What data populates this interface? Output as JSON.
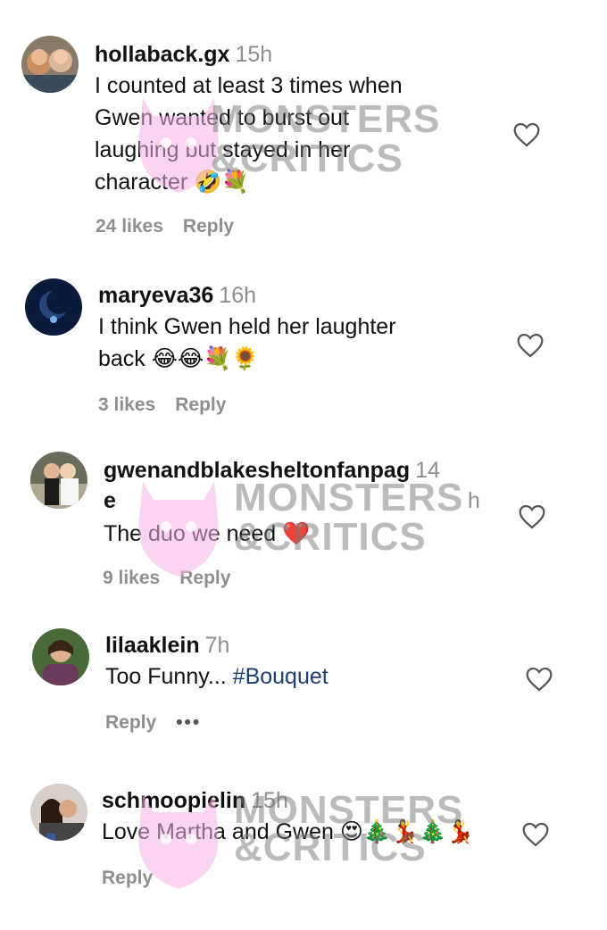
{
  "watermark": {
    "line1": "MONSTERS",
    "line2": "&CRITICS"
  },
  "comments": [
    {
      "username": "hollaback.gx",
      "time": "15h",
      "text_lines": [
        "I counted at least 3 times when",
        "Gwen wanted to burst out",
        "laughing but stayed in her",
        "character 🤣💐"
      ],
      "likes": "24 likes",
      "reply": "Reply"
    },
    {
      "username": "maryeva36",
      "time": "16h",
      "text_lines": [
        "I think Gwen held her laughter",
        "back 😂😂💐🌻"
      ],
      "likes": "3 likes",
      "reply": "Reply"
    },
    {
      "username_line1": "gwenandblakesheltonfanpag",
      "username_line2": "e",
      "time_line1": "14",
      "time_line2": "h",
      "text": "The duo we need ❤️",
      "likes": "9 likes",
      "reply": "Reply"
    },
    {
      "username": "lilaaklein",
      "time": "7h",
      "text_plain": "Too Funny... ",
      "hashtag": "#Bouquet",
      "reply": "Reply",
      "more": "•••"
    },
    {
      "username": "schmoopielin",
      "time": "15h",
      "text": "Love Martha and Gwen 😍🎄💃🎄💃",
      "reply": "Reply"
    }
  ],
  "colors": {
    "text": "#111111",
    "meta": "#8e8e8e",
    "hashtag": "#1c3f73",
    "watermark_pink": "#f5b3e6"
  }
}
